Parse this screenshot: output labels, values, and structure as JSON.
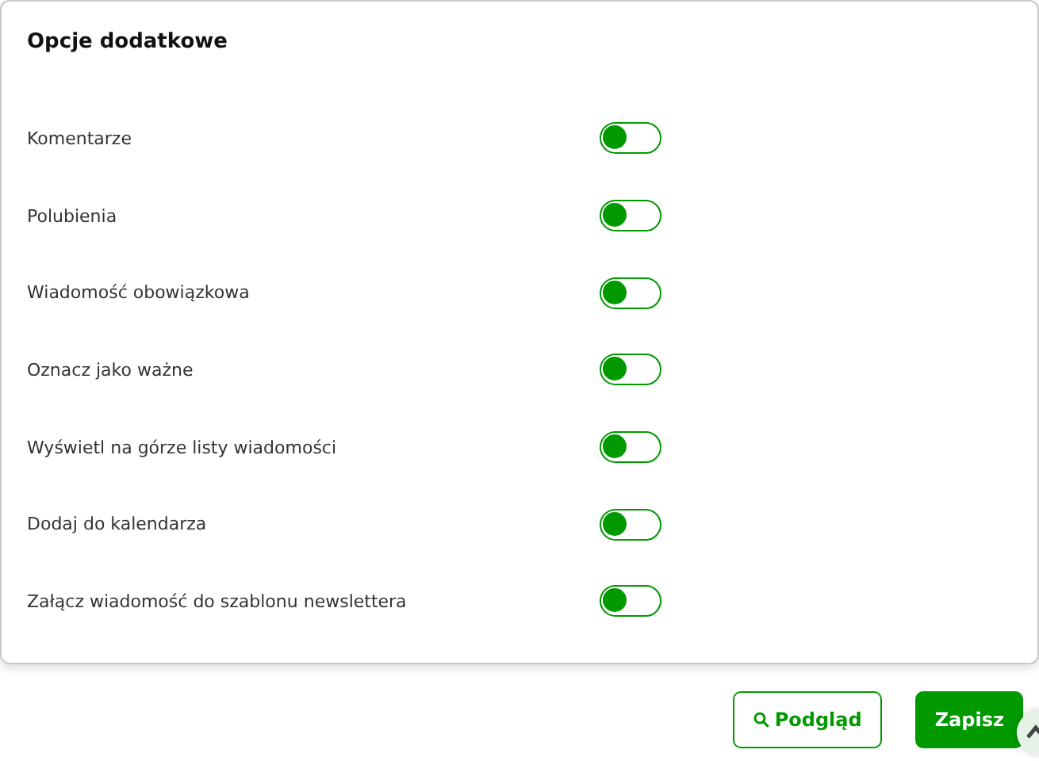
{
  "card": {
    "title": "Opcje dodatkowe",
    "options": [
      {
        "label": "Komentarze",
        "on": false
      },
      {
        "label": "Polubienia",
        "on": false
      },
      {
        "label": "Wiadomość obowiązkowa",
        "on": false
      },
      {
        "label": "Oznacz jako ważne",
        "on": false
      },
      {
        "label": "Wyświetl na górze listy wiadomości",
        "on": false
      },
      {
        "label": "Dodaj do kalendarza",
        "on": false
      },
      {
        "label": "Załącz wiadomość do szablonu newslettera",
        "on": false
      }
    ]
  },
  "buttons": [
    {
      "label": "Podgląd",
      "kind": "outline"
    },
    {
      "label": "Zapisz",
      "kind": "primary"
    }
  ]
}
